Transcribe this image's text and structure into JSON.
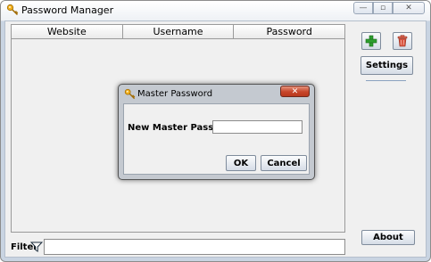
{
  "window": {
    "title": "Password Manager",
    "icon": "key-icon",
    "controls": {
      "minimize": "—",
      "maximize": "▫",
      "close": "✕"
    }
  },
  "table": {
    "columns": [
      "Website",
      "Username",
      "Password"
    ],
    "rows": []
  },
  "sidebar": {
    "add_icon": "add-icon",
    "delete_icon": "trash-icon",
    "settings_label": "Settings",
    "about_label": "About"
  },
  "filter": {
    "label": "Filter",
    "icon": "funnel-icon",
    "value": ""
  },
  "dialog": {
    "title": "Master Password",
    "icon": "key-icon",
    "close_glyph": "✕",
    "field_label": "New Master Password",
    "field_value": "",
    "ok_label": "OK",
    "cancel_label": "Cancel"
  },
  "colors": {
    "frame": "#c9d4e2",
    "close_button": "#c7452a",
    "add_green": "#2e9e2e",
    "delete_red": "#d9533f"
  }
}
